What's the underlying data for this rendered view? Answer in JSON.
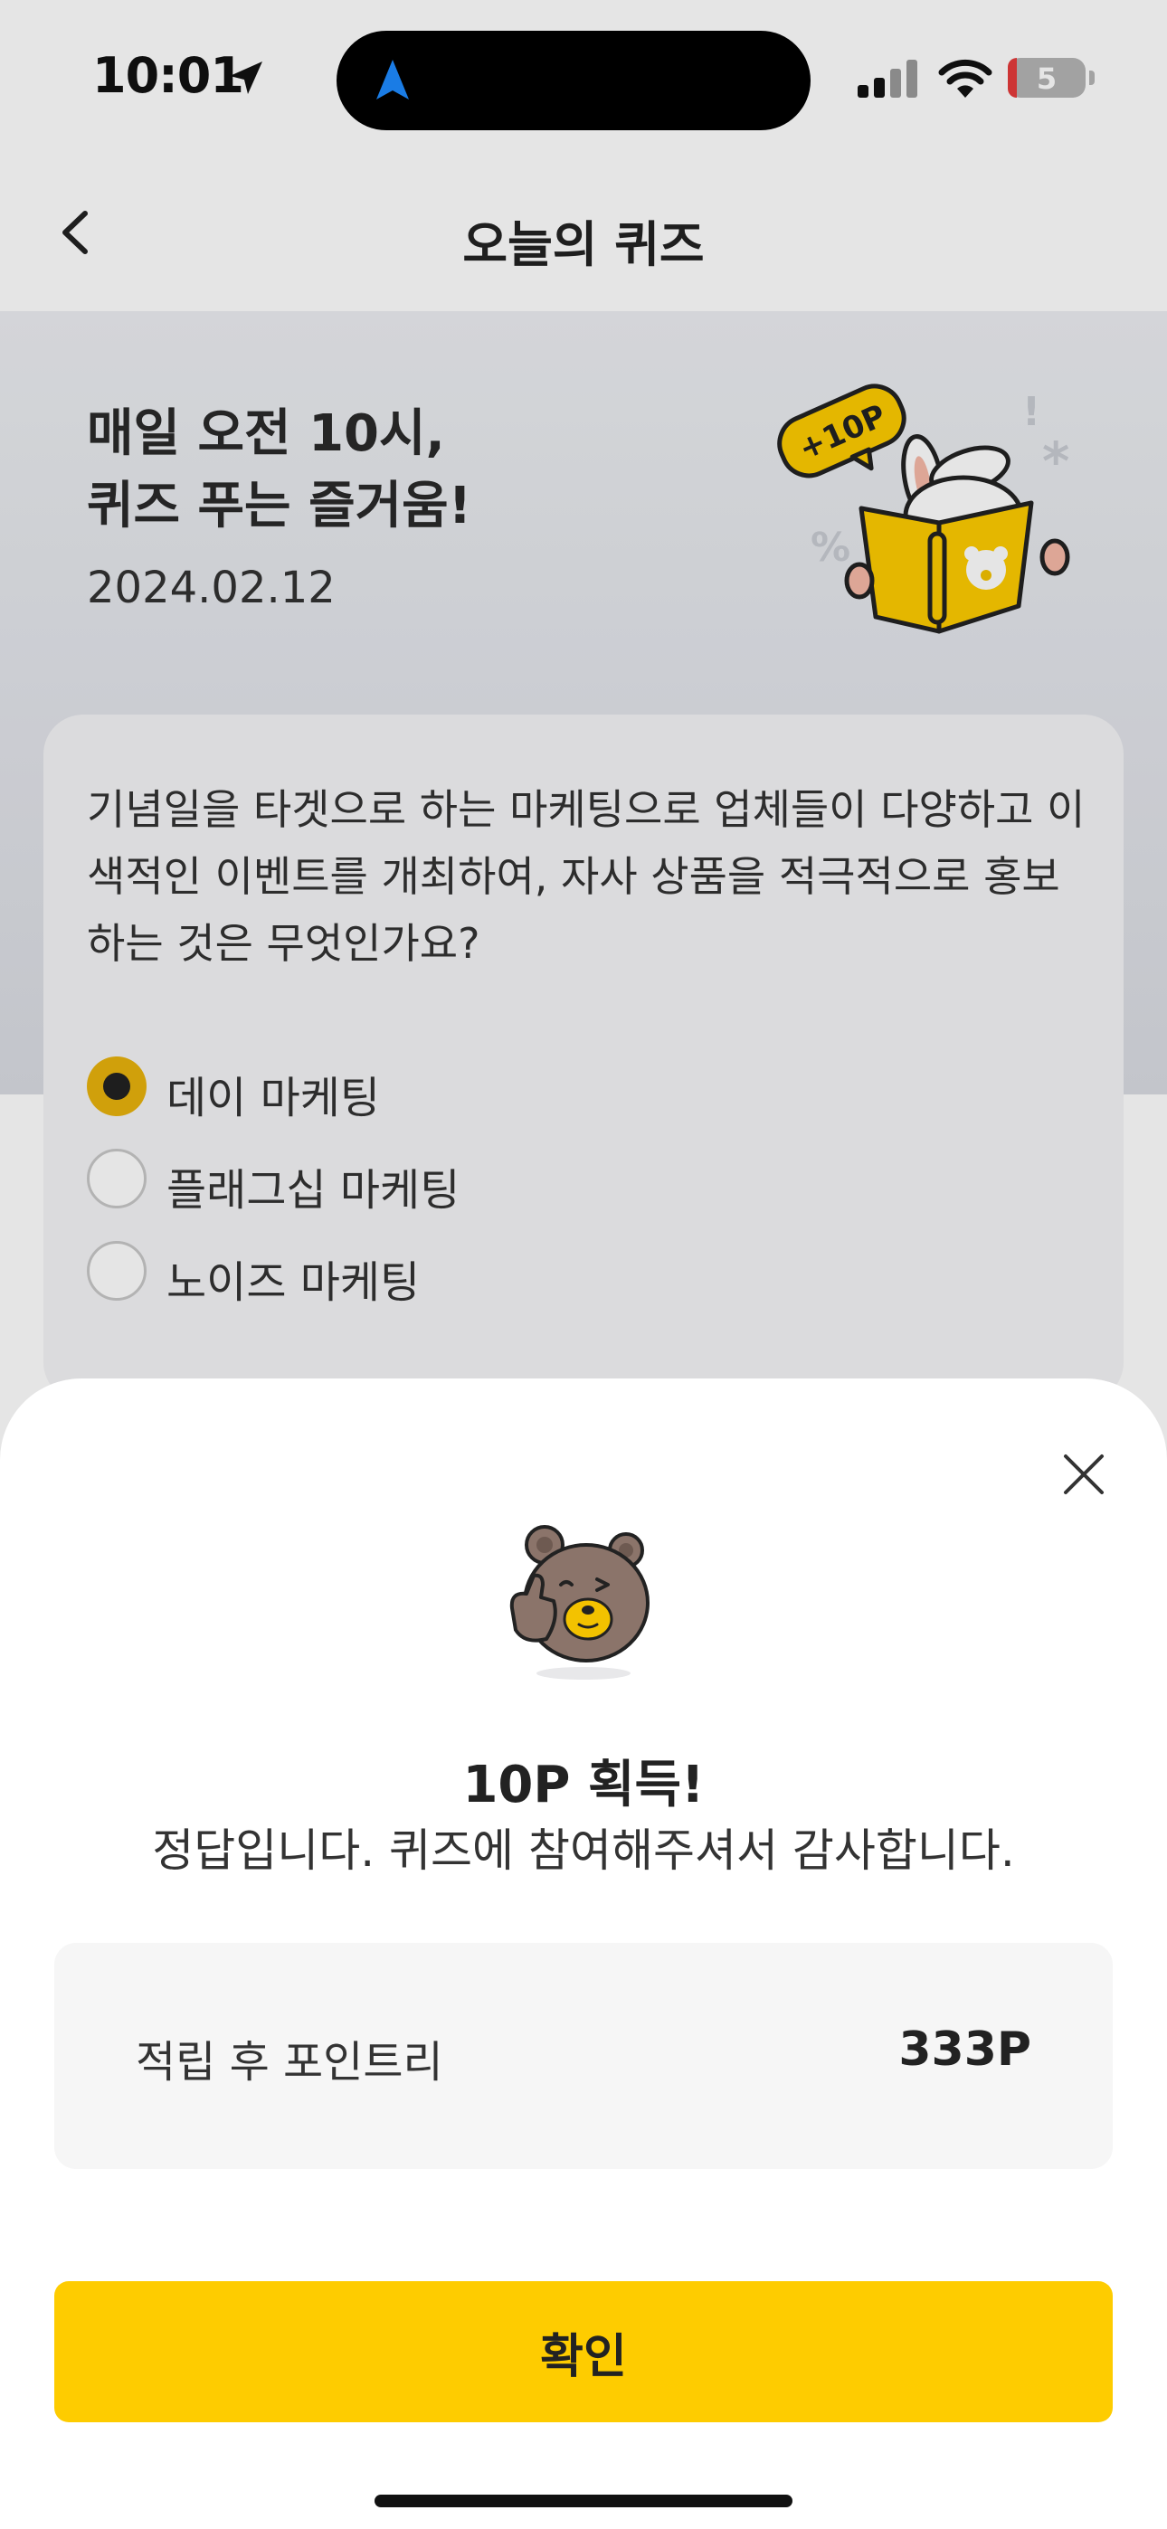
{
  "status_bar": {
    "time": "10:01",
    "battery": "5"
  },
  "nav": {
    "title": "오늘의 퀴즈"
  },
  "hero": {
    "headline_line1": "매일 오전 10시,",
    "headline_line2": "퀴즈 푸는 즐거움!",
    "date": "2024.02.12",
    "badge": "+10P"
  },
  "quiz": {
    "question": "기념일을 타겟으로 하는 마케팅으로 업체들이 다양하고 이색적인 이벤트를 개최하여, 자사 상품을 적극적으로 홍보하는 것은 무엇인가요?",
    "options": [
      {
        "label": "데이 마케팅",
        "selected": true
      },
      {
        "label": "플래그십 마케팅",
        "selected": false
      },
      {
        "label": "노이즈 마케팅",
        "selected": false
      }
    ]
  },
  "result_sheet": {
    "title": "10P 획득!",
    "message": "정답입니다. 퀴즈에 참여해주셔서 감사합니다.",
    "points_label": "적립 후 포인트리",
    "points_value": "333P",
    "confirm_label": "확인"
  },
  "colors": {
    "accent": "#fecc00",
    "radio_selected": "#e8b30d"
  },
  "icons": [
    "location-arrow-icon",
    "navigation-icon",
    "signal-icon",
    "wifi-icon",
    "battery-icon",
    "back-chevron-icon",
    "close-icon"
  ]
}
